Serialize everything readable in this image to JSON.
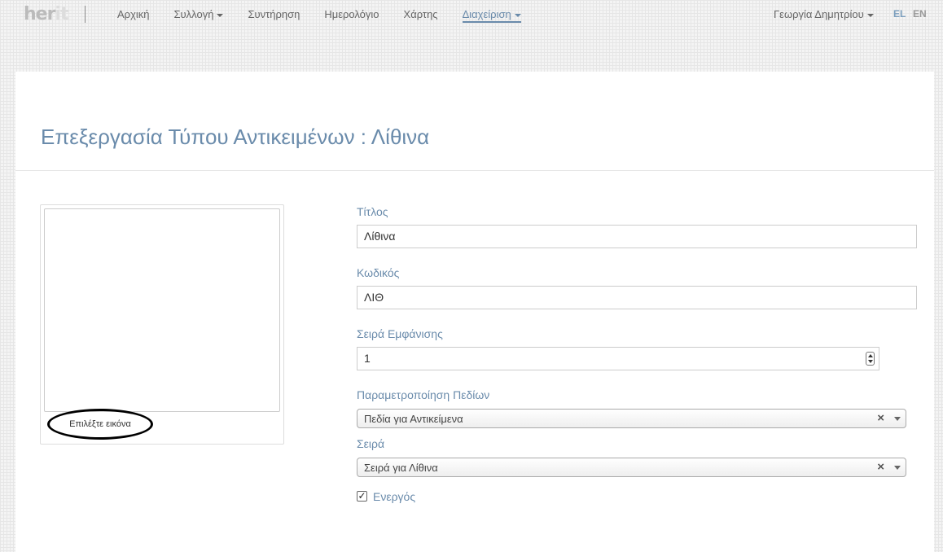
{
  "brand": {
    "logo_left": "her",
    "logo_right": "it"
  },
  "nav": {
    "items": [
      {
        "label": "Αρχική"
      },
      {
        "label": "Συλλογή"
      },
      {
        "label": "Συντήρηση"
      },
      {
        "label": "Ημερολόγιο"
      },
      {
        "label": "Χάρτης"
      },
      {
        "label": "Διαχείριση"
      }
    ],
    "user": "Γεωργία Δημητρίου",
    "lang_el": "EL",
    "lang_en": "EN"
  },
  "page": {
    "title": "Επεξεργασία Τύπου Αντικειμένων : Λίθινα"
  },
  "image": {
    "choose_label": "Επιλέξτε εικόνα"
  },
  "form": {
    "title_label": "Τίτλος",
    "title_value": "Λίθινα",
    "code_label": "Κωδικός",
    "code_value": "ΛΙΘ",
    "order_label": "Σειρά Εμφάνισης",
    "order_value": "1",
    "fields_label": "Παραμετροποίηση Πεδίων",
    "fields_value": "Πεδία για Αντικείμενα",
    "series_label": "Σειρά",
    "series_value": "Σειρά για Λίθινα",
    "active_label": "Ενεργός",
    "active_checked": true,
    "clear_glyph": "×"
  }
}
